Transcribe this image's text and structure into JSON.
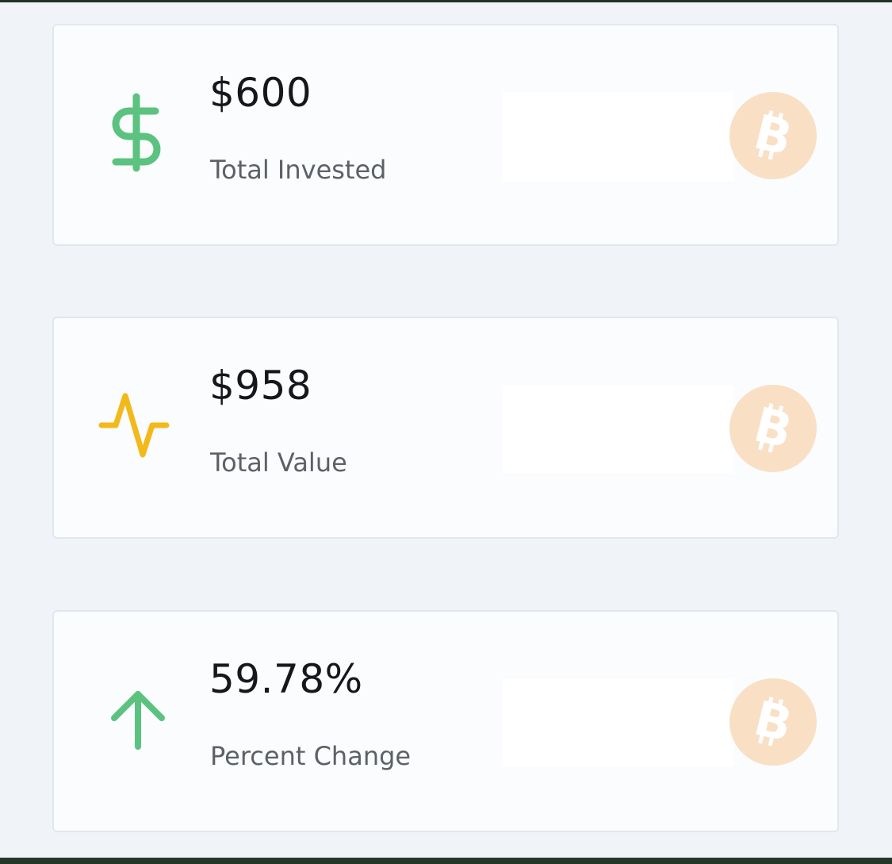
{
  "stats": [
    {
      "value": "$600",
      "label": "Total Invested",
      "icon": "dollar-icon",
      "icon_color": "#5cc27f"
    },
    {
      "value": "$958",
      "label": "Total Value",
      "icon": "activity-icon",
      "icon_color": "#f3b81a"
    },
    {
      "value": "59.78%",
      "label": "Percent Change",
      "icon": "arrow-up-icon",
      "icon_color": "#5cc27f"
    }
  ],
  "coin": {
    "icon": "bitcoin-icon",
    "color": "#f9dfc4"
  },
  "colors": {
    "background": "#f0f4f9",
    "card": "#fafcfe",
    "value_text": "#15171a",
    "label_text": "#5d6167"
  }
}
